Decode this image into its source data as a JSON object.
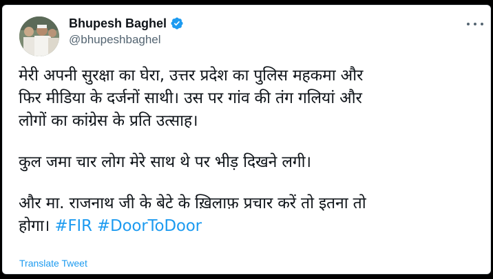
{
  "tweet": {
    "author_name": "Bhupesh Baghel",
    "author_handle": "@bhupeshbaghel",
    "verified_icon": "verified-badge-icon",
    "more_icon": "more-options-icon",
    "paragraph1_line1": "मेरी अपनी सुरक्षा का घेरा, उत्तर प्रदेश का पुलिस महकमा और",
    "paragraph1_line2": "फिर मीडिया के दर्जनों साथी। उस पर गांव की तंग गलियां और",
    "paragraph1_line3": "लोगों का कांग्रेस के प्रति उत्साह।",
    "paragraph2_line1": "कुल जमा चार लोग मेरे साथ थे पर भीड़ दिखने लगी।",
    "paragraph3_line1": "और मा. राजनाथ जी के बेटे के ख़िलाफ़ प्रचार करें तो इतना तो",
    "paragraph3_line2_text": "होगा।",
    "hashtags": [
      "#FIR",
      "#DoorToDoor"
    ],
    "translate_label": "Translate Tweet"
  },
  "colors": {
    "accent": "#1d9bf0",
    "text": "#0f1419",
    "secondary": "#536471",
    "background": "#ffffff"
  }
}
